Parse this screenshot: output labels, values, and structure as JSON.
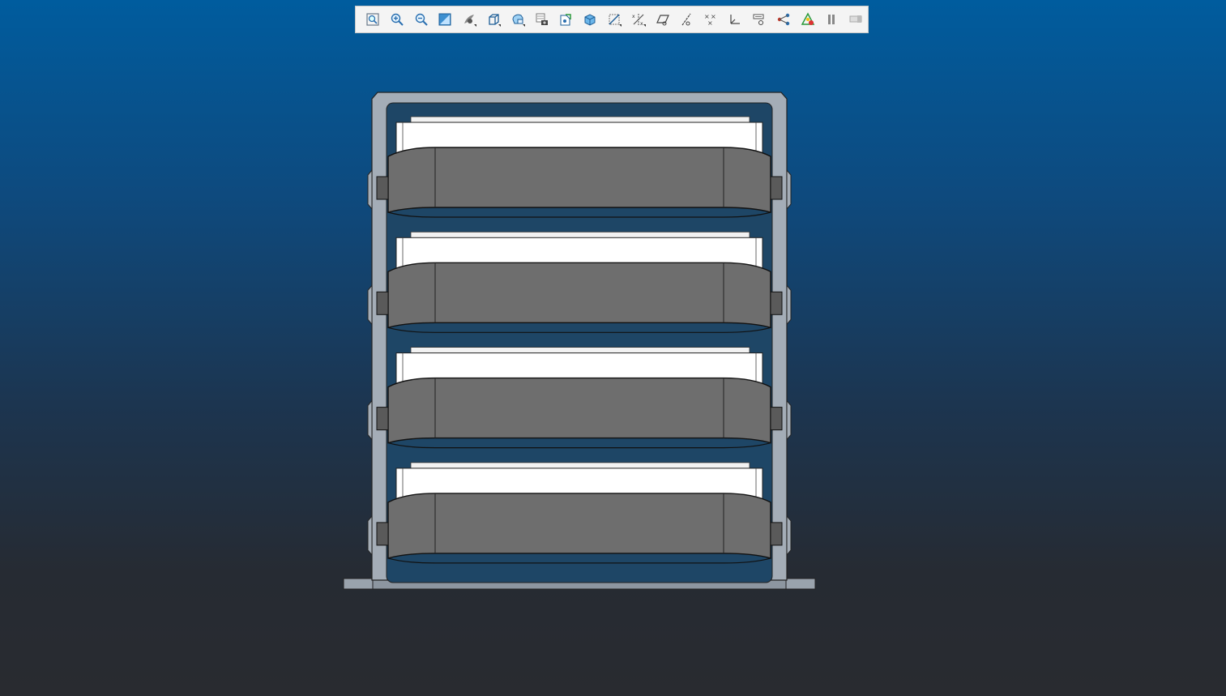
{
  "viewport": {
    "background_top": "#005c9e",
    "background_bottom": "#292b30"
  },
  "toolbar": {
    "items": [
      {
        "name": "zoom-to-fit-icon"
      },
      {
        "name": "zoom-in-icon"
      },
      {
        "name": "zoom-out-icon"
      },
      {
        "name": "repaint-icon"
      },
      {
        "name": "display-style-icon",
        "flyout": true
      },
      {
        "name": "saved-orientations-icon",
        "flyout": true
      },
      {
        "name": "view-manager-icon",
        "flyout": true
      },
      {
        "name": "perspective-camera-icon"
      },
      {
        "name": "spin-center-icon"
      },
      {
        "name": "named-views-icon"
      },
      {
        "name": "section-view-icon",
        "flyout": true
      },
      {
        "name": "datum-display-filter-icon",
        "flyout": true
      },
      {
        "name": "plane-display-icon"
      },
      {
        "name": "axis-display-icon"
      },
      {
        "name": "point-display-icon"
      },
      {
        "name": "csys-display-icon"
      },
      {
        "name": "annotation-display-icon"
      },
      {
        "name": "model-tree-display-icon"
      },
      {
        "name": "appearance-icon"
      },
      {
        "name": "pause-icon"
      },
      {
        "name": "next-icon"
      }
    ]
  },
  "model": {
    "frame_color": "#a4adb7",
    "tray_front_color": "#6e6e6e",
    "tray_body_color": "#ffffff",
    "tray_count": 4
  }
}
